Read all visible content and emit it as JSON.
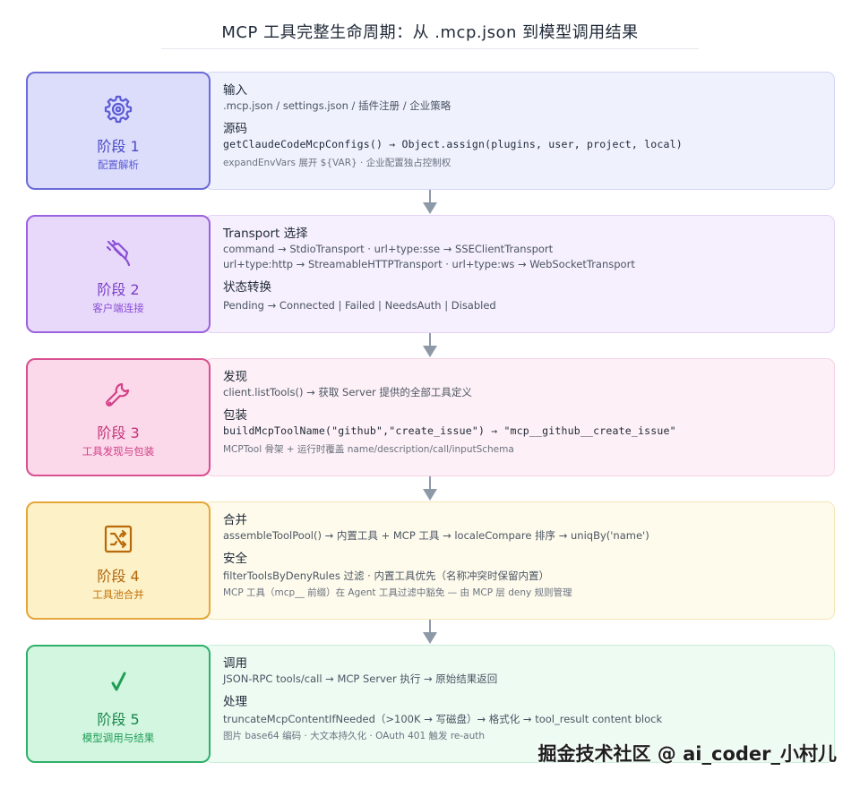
{
  "title": "MCP 工具完整生命周期：从 .mcp.json 到模型调用结果",
  "stages": [
    {
      "name": "阶段 1",
      "subtitle": "配置解析",
      "icon": "gear-icon",
      "color": "#5b5bd6",
      "sections": [
        {
          "heading": "输入",
          "lines": [
            ".mcp.json / settings.json / 插件注册 / 企业策略"
          ]
        },
        {
          "heading": "源码",
          "code": "getClaudeCodeMcpConfigs() → Object.assign(plugins, user, project, local)",
          "note": "expandEnvVars 展开 ${VAR} · 企业配置独占控制权"
        }
      ]
    },
    {
      "name": "阶段 2",
      "subtitle": "客户端连接",
      "icon": "plug-icon",
      "color": "#8b4fd6",
      "sections": [
        {
          "heading": "Transport 选择",
          "lines": [
            "command → StdioTransport · url+type:sse → SSEClientTransport",
            "url+type:http → StreamableHTTPTransport · url+type:ws → WebSocketTransport"
          ]
        },
        {
          "heading": "状态转换",
          "lines": [
            "Pending → Connected | Failed | NeedsAuth | Disabled"
          ]
        }
      ]
    },
    {
      "name": "阶段 3",
      "subtitle": "工具发现与包装",
      "icon": "wrench-icon",
      "color": "#d23f86",
      "sections": [
        {
          "heading": "发现",
          "lines": [
            "client.listTools() → 获取 Server 提供的全部工具定义"
          ]
        },
        {
          "heading": "包装",
          "code": "buildMcpToolName(\"github\",\"create_issue\") → \"mcp__github__create_issue\"",
          "note": "MCPTool 骨架 + 运行时覆盖 name/description/call/inputSchema"
        }
      ]
    },
    {
      "name": "阶段 4",
      "subtitle": "工具池合并",
      "icon": "shuffle-icon",
      "color": "#c2730c",
      "sections": [
        {
          "heading": "合并",
          "lines": [
            "assembleToolPool() → 内置工具 + MCP 工具 → localeCompare 排序 → uniqBy('name')"
          ]
        },
        {
          "heading": "安全",
          "lines": [
            "filterToolsByDenyRules 过滤 · 内置工具优先（名称冲突时保留内置）"
          ],
          "note": "MCP 工具（mcp__ 前缀）在 Agent 工具过滤中豁免 — 由 MCP 层 deny 规则管理"
        }
      ]
    },
    {
      "name": "阶段 5",
      "subtitle": "模型调用与结果",
      "icon": "checkmark-icon",
      "color": "#1f9d55",
      "sections": [
        {
          "heading": "调用",
          "lines": [
            "JSON-RPC tools/call → MCP Server 执行 → 原始结果返回"
          ]
        },
        {
          "heading": "处理",
          "lines": [
            "truncateMcpContentIfNeeded（>100K → 写磁盘）→ 格式化 → tool_result content block"
          ],
          "note": "图片 base64 编码 · 大文本持久化 · OAuth 401 触发 re-auth"
        }
      ]
    }
  ],
  "watermark": "掘金技术社区 @ ai_coder_小村儿"
}
